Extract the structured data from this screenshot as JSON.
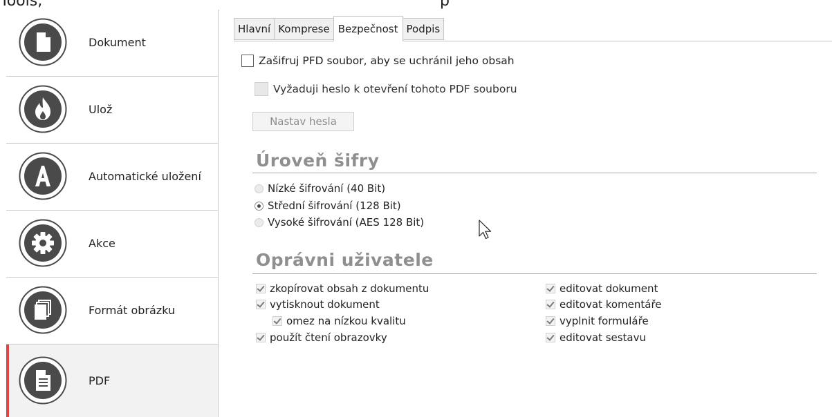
{
  "top_caption": {
    "left": "Tools,",
    "right": "p"
  },
  "sidebar": {
    "items": [
      {
        "label": "Dokument",
        "icon": "document-icon"
      },
      {
        "label": "Ulož",
        "icon": "flame-icon"
      },
      {
        "label": "Automatické uložení",
        "icon": "letter-a-icon"
      },
      {
        "label": "Akce",
        "icon": "gear-icon"
      },
      {
        "label": "Formát obrázku",
        "icon": "image-format-icon"
      },
      {
        "label": "PDF",
        "icon": "pdf-document-icon"
      }
    ],
    "active_index": 5,
    "accent_color": "#e04545"
  },
  "tabs": [
    {
      "label": "Hlavní"
    },
    {
      "label": "Komprese"
    },
    {
      "label": "Bezpečnost",
      "active": true
    },
    {
      "label": "Podpis"
    }
  ],
  "security": {
    "encrypt_label": "Zašifruj PFD soubor, aby se uchránil jeho obsah",
    "encrypt_checked": false,
    "require_password_label": "Vyžaduji heslo k otevření tohoto PDF souboru",
    "require_password_checked": false,
    "require_password_enabled": false,
    "set_passwords_button": "Nastav hesla"
  },
  "encryption_level": {
    "title": "Úroveň šifry",
    "options": [
      {
        "label": "Nízké šifrování (40 Bit)",
        "selected": false
      },
      {
        "label": "Střední šifrování (128 Bit)",
        "selected": true
      },
      {
        "label": "Vysoké šifrování (AES 128 Bit)",
        "selected": false
      }
    ]
  },
  "user_permissions": {
    "title": "Oprávni uživatele",
    "left": [
      {
        "label": "zkopírovat obsah z dokumentu",
        "checked": true
      },
      {
        "label": "vytisknout dokument",
        "checked": true
      },
      {
        "label": "omez na nízkou kvalitu",
        "checked": true
      },
      {
        "label": "použít čtení obrazovky",
        "checked": true
      }
    ],
    "right": [
      {
        "label": "editovat dokument",
        "checked": true
      },
      {
        "label": "editovat komentáře",
        "checked": true
      },
      {
        "label": "vyplnit formuláře",
        "checked": true
      },
      {
        "label": "editovat sestavu",
        "checked": true
      }
    ]
  }
}
